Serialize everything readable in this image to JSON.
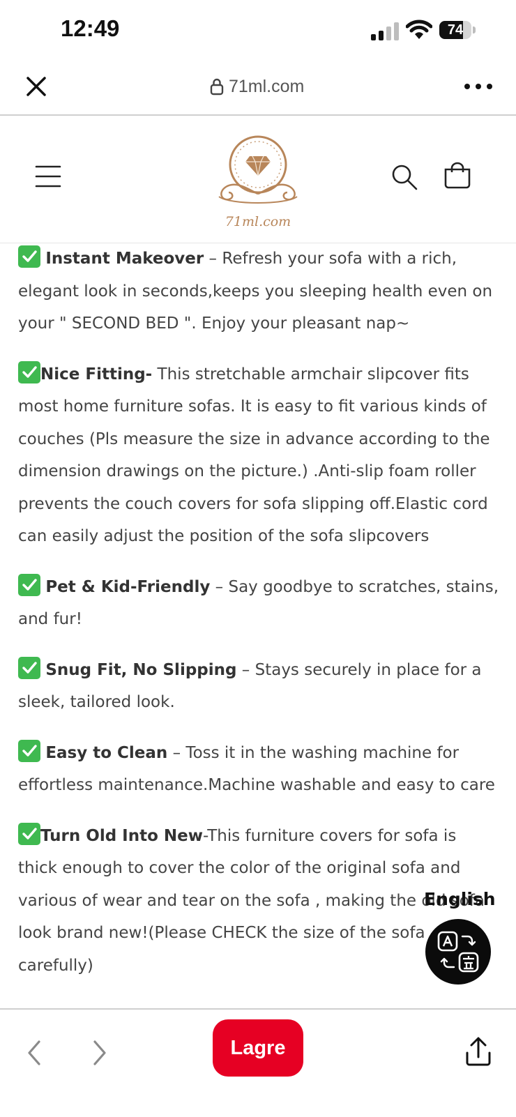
{
  "status_bar": {
    "time": "12:49",
    "battery": "74",
    "battery_level": 0.74
  },
  "browser": {
    "url": "71ml.com",
    "icons": [
      "close-icon",
      "lock-icon",
      "more-icon"
    ]
  },
  "site_header": {
    "logo_text": "71ml.com",
    "icons": [
      "menu-icon",
      "search-icon",
      "cart-icon"
    ]
  },
  "features": [
    {
      "title": "Instant Makeover",
      "separator": " – ",
      "text": "Refresh your sofa with a rich, elegant look in seconds,keeps you sleeping health even on your \" SECOND BED \". Enjoy your pleasant nap~"
    },
    {
      "title": "Nice Fitting-",
      "separator": " ",
      "text": "This stretchable armchair slipcover fits most home furniture sofas. It is easy to fit various kinds of couches (Pls measure the size in advance according to the dimension drawings on the picture.) .Anti-slip foam roller prevents the couch covers for sofa slipping off.Elastic cord can easily adjust the position of the sofa slipcovers"
    },
    {
      "title": "Pet & Kid-Friendly",
      "separator": " – ",
      "text": "Say goodbye to scratches, stains, and fur!"
    },
    {
      "title": "Snug Fit, No Slipping",
      "separator": " – ",
      "text": "Stays securely in place for a sleek, tailored look."
    },
    {
      "title": "Easy to Clean",
      "separator": " – ",
      "text": "Toss it in the washing machine for effortless maintenance.Machine washable and easy to care"
    },
    {
      "title": "Turn Old Into New",
      "separator": "-",
      "text": "This furniture covers for sofa is thick enough to cover the color of the original sofa and various of wear and tear on the sofa , making the old sofa look brand new!(Please CHECK the size of the sofa carefully)"
    }
  ],
  "translate_widget": {
    "language": "English",
    "icon": "translate-icon"
  },
  "bottom_bar": {
    "save_label": "Lagre",
    "icons": [
      "back-icon",
      "forward-icon",
      "share-icon"
    ]
  },
  "colors": {
    "save_button": "#e60023",
    "checkmark": "#3fb950",
    "logo_gold": "#b8865a"
  }
}
